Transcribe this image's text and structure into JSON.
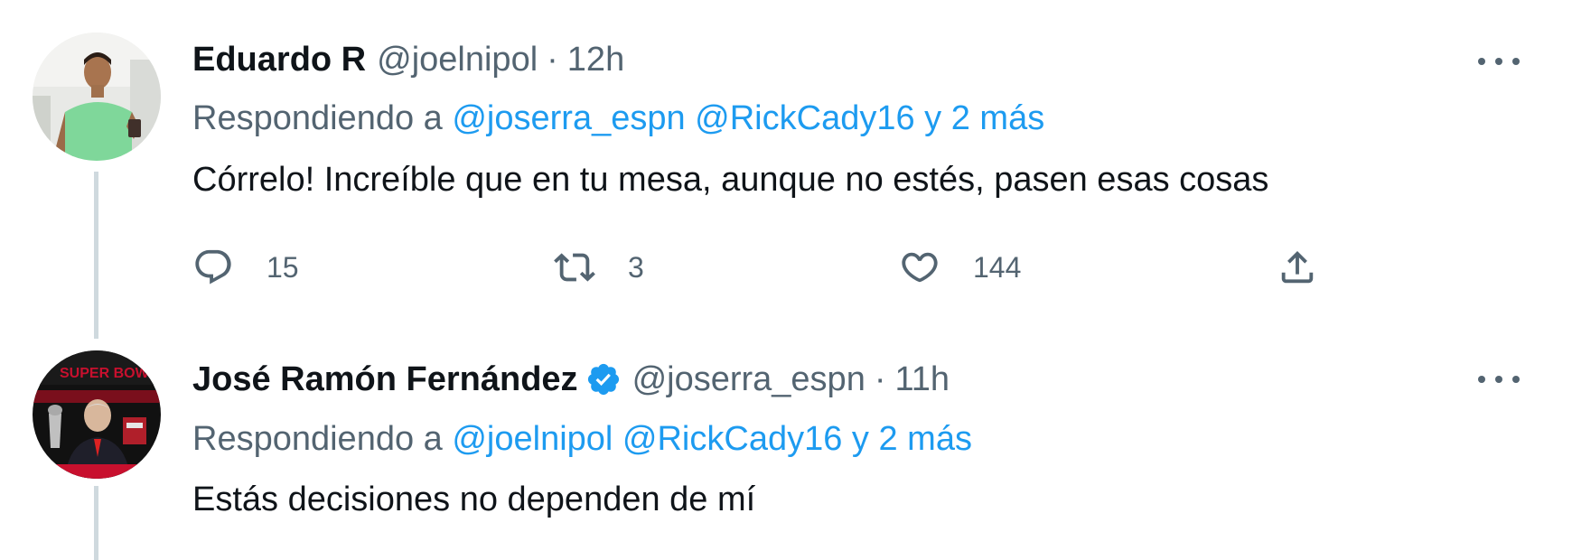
{
  "tweets": [
    {
      "display_name": "Eduardo R",
      "handle": "@joelnipol",
      "separator": "·",
      "time": "12h",
      "verified": false,
      "replying_prefix": "Respondiendo a",
      "replying_to": "@joserra_espn @RickCady16 y 2 más",
      "text": "Córrelo! Increíble que en tu mesa, aunque no estés, pasen esas cosas",
      "reply_count": "15",
      "retweet_count": "3",
      "like_count": "144"
    },
    {
      "display_name": "José Ramón Fernández",
      "handle": "@joserra_espn",
      "separator": "·",
      "time": "11h",
      "verified": true,
      "replying_prefix": "Respondiendo a",
      "replying_to": "@joelnipol @RickCady16 y 2 más",
      "text": "Estás decisiones no dependen de mí"
    }
  ],
  "icons": {
    "more": "more-icon",
    "reply": "reply-icon",
    "retweet": "retweet-icon",
    "like": "heart-icon",
    "share": "share-icon",
    "verified": "verified-badge-icon"
  },
  "colors": {
    "link": "#1d9bf0",
    "secondary_text": "#536471",
    "primary_text": "#0f1419",
    "thread_line": "#cfd9de",
    "verified": "#1d9bf0"
  }
}
